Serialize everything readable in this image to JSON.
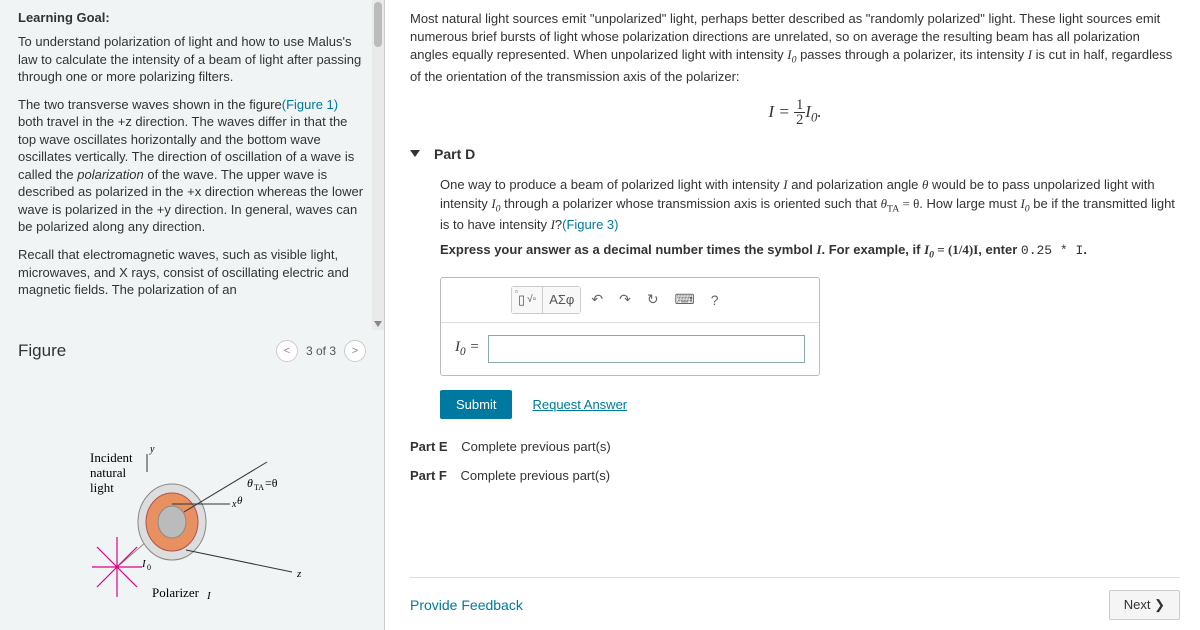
{
  "left": {
    "goal_title": "Learning Goal:",
    "goal_p1": "To understand polarization of light and how to use Malus's law to calculate the intensity of a beam of light after passing through one or more polarizing filters.",
    "goal_p2a": "The two transverse waves shown in the figure",
    "goal_p2_link": "(Figure 1)",
    "goal_p2b": " both travel in the +z direction. The waves differ in that the top wave oscillates horizontally and the bottom wave oscillates vertically. The direction of oscillation of a wave is called the ",
    "goal_p2_italic": "polarization",
    "goal_p2c": " of the wave. The upper wave is described as polarized in the +x direction whereas the lower wave is polarized in the +y direction. In general, waves can be polarized along any direction.",
    "goal_p3": "Recall that electromagnetic waves, such as visible light, microwaves, and X rays, consist of oscillating electric and magnetic fields. The polarization of an",
    "figure_title": "Figure",
    "pager_prev": "<",
    "pager_label": "3 of 3",
    "pager_next": ">",
    "fig_incident": "Incident\nnatural\nlight",
    "fig_polarizer": "Polarizer",
    "fig_theta": "θ_TA=θ"
  },
  "right": {
    "intro_a": "Most natural light sources emit \"unpolarized\" light, perhaps better described as \"randomly polarized\" light. These light sources emit numerous brief bursts of light whose polarization directions are unrelated, so on average the resulting beam has all polarization angles equally represented. When unpolarized light with intensity ",
    "intro_b": " passes through a polarizer, its intensity ",
    "intro_c": " is cut in half, regardless of the orientation of the transmission axis of the polarizer:",
    "formula_lhs": "I = ",
    "formula_frac_num": "1",
    "formula_frac_den": "2",
    "formula_rhs": "I",
    "formula_sub": "0",
    "partD_label": "Part D",
    "partD_q_a": "One way to produce a beam of polarized light with intensity ",
    "partD_q_b": " and polarization angle ",
    "partD_q_c": " would be to pass unpolarized light with intensity ",
    "partD_q_d": " through a polarizer whose transmission axis is oriented such that ",
    "partD_q_e": ". How large must ",
    "partD_q_f": " be if the transmitted light is to have intensity ",
    "partD_q_g": "?",
    "partD_figlink": "(Figure 3)",
    "theta_TA": "θ",
    "theta_TA_sub": "TA",
    "eq_theta": " = θ",
    "instruction_a": "Express your answer as a decimal number times the symbol ",
    "instruction_b": ". For example, if ",
    "instruction_c": " = (1/4)I",
    "instruction_d": ", enter ",
    "instruction_code": "0.25 * I",
    "instruction_e": ".",
    "tool_template": "▭",
    "tool_sqrt": "√▫",
    "tool_greek": "ΑΣφ",
    "tool_undo": "↶",
    "tool_redo": "↷",
    "tool_reset": "↻",
    "tool_keyboard": "⌨",
    "tool_help": "?",
    "input_label_I": "I",
    "input_label_sub": "0",
    "input_label_eq": " = ",
    "submit": "Submit",
    "request": "Request Answer",
    "partE_label": "Part E",
    "partE_msg": "Complete previous part(s)",
    "partF_label": "Part F",
    "partF_msg": "Complete previous part(s)",
    "feedback": "Provide Feedback",
    "next": "Next ❯"
  }
}
